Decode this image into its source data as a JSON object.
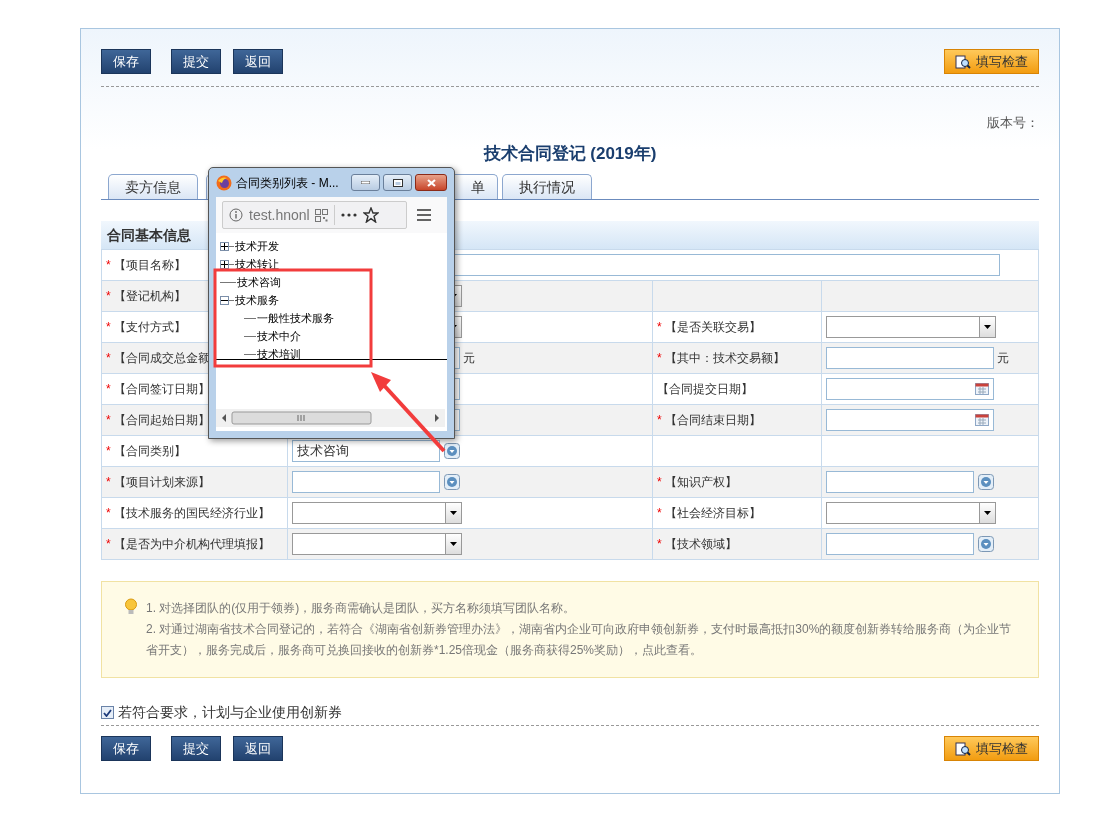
{
  "toolbar_top": {
    "buttons": [
      {
        "label": "保存"
      },
      {
        "label": "提交"
      },
      {
        "label": "返回"
      }
    ],
    "check_button": "填写检查"
  },
  "version_label": "版本号：",
  "title": "技术合同登记 (2019年)",
  "tabs": [
    {
      "label": "卖方信息",
      "selected": false
    },
    {
      "label": "单",
      "selected": false
    },
    {
      "label": "执行情况",
      "selected": false
    }
  ],
  "section_title": "合同基本信息",
  "rows": [
    {
      "left": {
        "star": "*",
        "label": "【项目名称】",
        "field": {
          "kind": "wide"
        }
      }
    },
    {
      "left": {
        "star": "*",
        "label": "【登记机构】",
        "field": {
          "kind": "select"
        }
      },
      "right": {}
    },
    {
      "left": {
        "star": "*",
        "label": "【支付方式】",
        "field": {
          "kind": "select"
        }
      },
      "right": {
        "star": "*",
        "label": "【是否关联交易】",
        "field": {
          "kind": "select"
        }
      }
    },
    {
      "left": {
        "star": "*",
        "label": "【合同成交总金额",
        "field": {
          "kind": "money",
          "unit": "元"
        }
      },
      "right": {
        "star": "*",
        "label": "【其中：技术交易额】",
        "field": {
          "kind": "money",
          "unit": "元"
        }
      }
    },
    {
      "left": {
        "star": "*",
        "label": "【合同签订日期】",
        "field": {
          "kind": "date"
        }
      },
      "right": {
        "label": "【合同提交日期】",
        "field": {
          "kind": "date"
        }
      }
    },
    {
      "left": {
        "star": "*",
        "label": "【合同起始日期】",
        "field": {
          "kind": "date"
        }
      },
      "right": {
        "star": "*",
        "label": "【合同结束日期】",
        "field": {
          "kind": "date"
        }
      }
    },
    {
      "left": {
        "star": "*",
        "label": "【合同类别】",
        "field": {
          "kind": "picker",
          "value": "技术咨询"
        }
      },
      "right": {}
    },
    {
      "left": {
        "star": "*",
        "label": "【项目计划来源】",
        "field": {
          "kind": "picker"
        }
      },
      "right": {
        "star": "*",
        "label": "【知识产权】",
        "field": {
          "kind": "picker"
        }
      }
    },
    {
      "left": {
        "star": "*",
        "label": "【技术服务的国民经济行业】",
        "field": {
          "kind": "select"
        }
      },
      "right": {
        "star": "*",
        "label": "【社会经济目标】",
        "field": {
          "kind": "select"
        }
      }
    },
    {
      "left": {
        "star": "*",
        "label": "【是否为中介机构代理填报】",
        "field": {
          "kind": "select"
        }
      },
      "right": {
        "star": "*",
        "label": "【技术领域】",
        "field": {
          "kind": "picker"
        }
      }
    }
  ],
  "notice": [
    "1. 对选择团队的(仅用于领券)，服务商需确认是团队，买方名称须填写团队名称。",
    "2. 对通过湖南省技术合同登记的，若符合《湖南省创新券管理办法》，湖南省内企业可向政府申领创新券，支付时最高抵扣30%的额度创新券转给服务商（为企业节省开支），服务完成后，服务商可兑换回接收的创新券*1.25倍现金（服务商获得25%奖励），点此查看。"
  ],
  "voucher_checkbox": {
    "label": "若符合要求，计划与企业使用创新券",
    "checked": true
  },
  "toolbar_bottom": {
    "buttons": [
      {
        "label": "保存"
      },
      {
        "label": "提交"
      },
      {
        "label": "返回"
      }
    ],
    "check_button": "填写检查"
  },
  "popup": {
    "title": "合同类别列表 - M...",
    "address": "test.hnonl",
    "tree": [
      {
        "label": "技术开发",
        "expanded": false
      },
      {
        "label": "技术转让",
        "expanded": false
      },
      {
        "label": "技术咨询"
      },
      {
        "label": "技术服务",
        "expanded": true,
        "children": [
          {
            "label": "一般性技术服务"
          },
          {
            "label": "技术中介"
          },
          {
            "label": "技术培训"
          }
        ]
      }
    ]
  }
}
